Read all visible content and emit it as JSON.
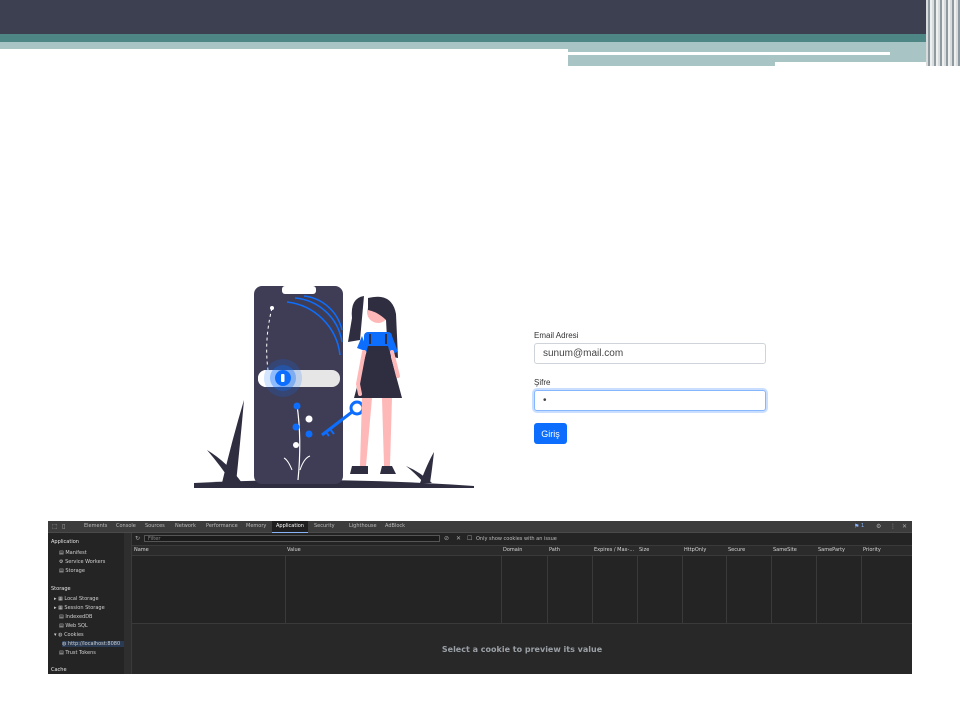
{
  "login": {
    "email_label": "Email Adresi",
    "email_value": "sunum@mail.com",
    "password_label": "Şifre",
    "password_value": "•",
    "submit_label": "Giriş"
  },
  "devtools": {
    "tabs": [
      "Elements",
      "Console",
      "Sources",
      "Network",
      "Performance",
      "Memory",
      "Application",
      "Security",
      "Lighthouse",
      "AdBlock"
    ],
    "active_tab": "Application",
    "issues_badge": "1",
    "filter_placeholder": "Filter",
    "only_issue_label": "Only show cookies with an issue",
    "sidebar": {
      "application_header": "Application",
      "application_items": [
        "Manifest",
        "Service Workers",
        "Storage"
      ],
      "storage_header": "Storage",
      "storage_items": [
        "Local Storage",
        "Session Storage",
        "IndexedDB",
        "Web SQL",
        "Cookies"
      ],
      "cookie_origin": "http://localhost:8080",
      "trust_tokens": "Trust Tokens",
      "cache_header": "Cache"
    },
    "columns": [
      "Name",
      "Value",
      "Domain",
      "Path",
      "Expires / Max-...",
      "Size",
      "HttpOnly",
      "Secure",
      "SameSite",
      "SameParty",
      "Priority"
    ],
    "preview_message": "Select a cookie to preview its value"
  },
  "colors": {
    "primary": "#0d6efd",
    "slide_topbar": "#3d4050",
    "slide_teal": "#4e8585",
    "devtools_bg": "#242424"
  }
}
